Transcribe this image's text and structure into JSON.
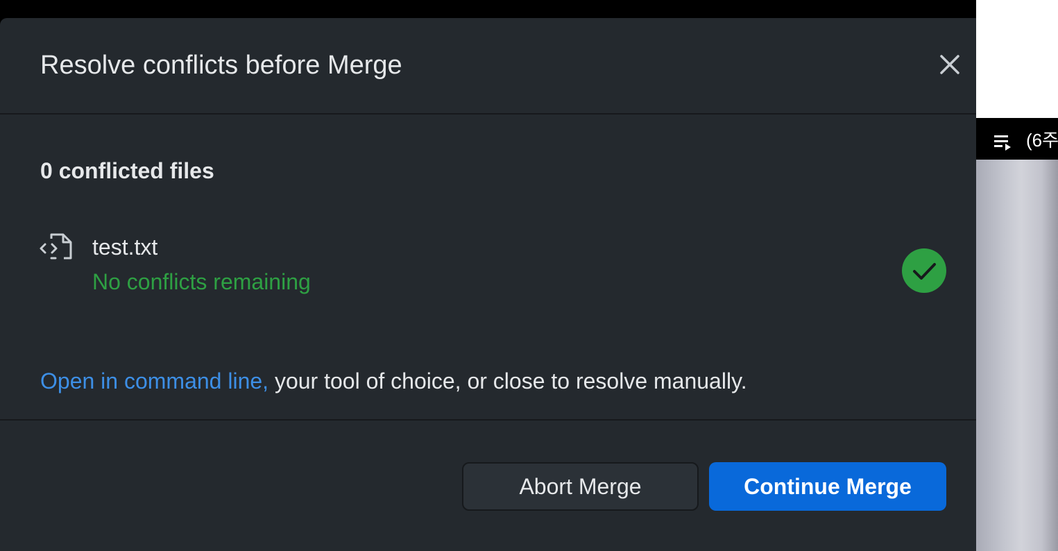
{
  "dialog": {
    "title": "Resolve conflicts before Merge",
    "close_icon": "close-icon"
  },
  "conflicts": {
    "heading": "0 conflicted files",
    "files": [
      {
        "name": "test.txt",
        "status": "No conflicts remaining",
        "icon": "file-code-icon",
        "badge_icon": "check-circle-icon"
      }
    ]
  },
  "help": {
    "link_text": "Open in command line,",
    "rest_text": " your tool of choice, or close to resolve manually."
  },
  "footer": {
    "abort_label": "Abort Merge",
    "continue_label": "Continue Merge"
  },
  "background": {
    "playlist_icon": "playlist-play-icon",
    "partial_text": "(6주"
  },
  "colors": {
    "dialog_bg": "#24292e",
    "success": "#2ea043",
    "link": "#3d8fe6",
    "primary": "#0969da"
  }
}
